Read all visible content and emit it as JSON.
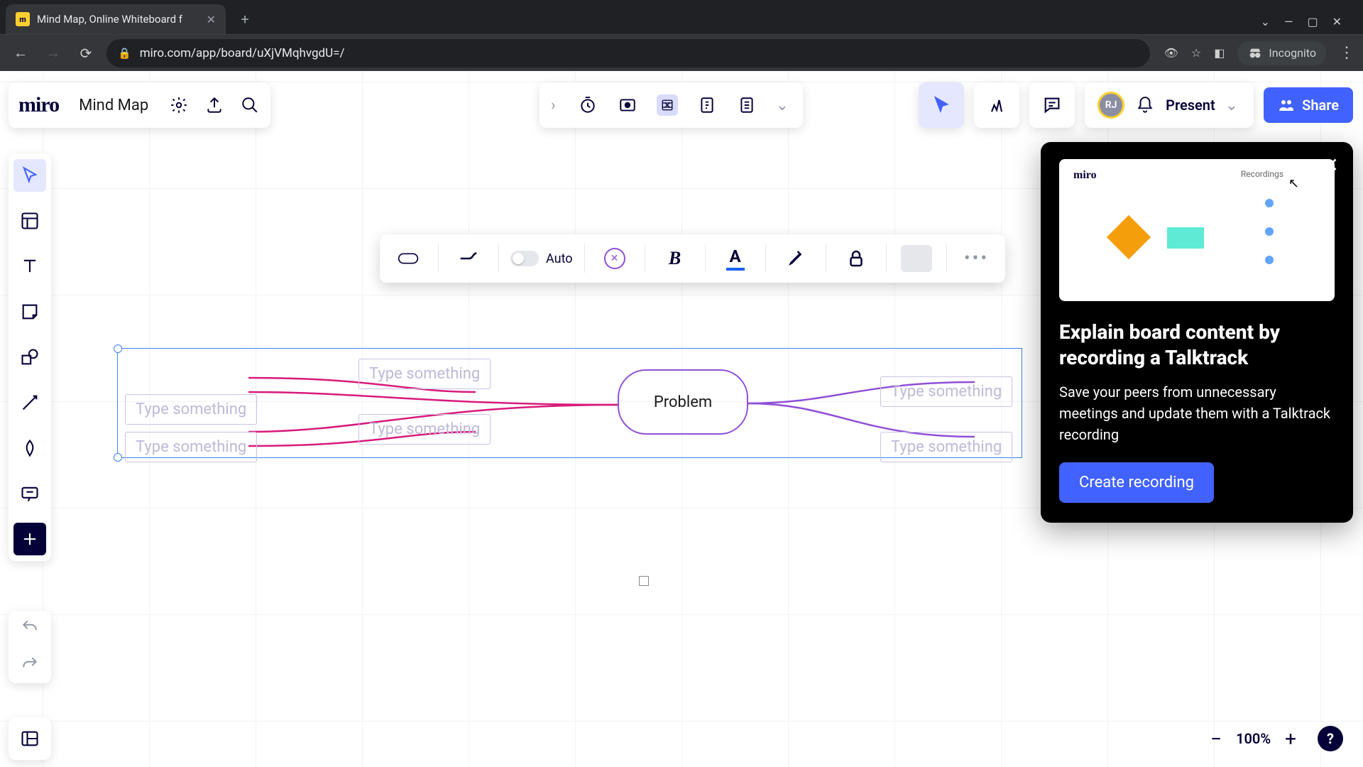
{
  "browser": {
    "tab_title": "Mind Map, Online Whiteboard f",
    "url": "miro.com/app/board/uXjVMqhvgdU=/",
    "incognito_label": "Incognito"
  },
  "header": {
    "logo": "miro",
    "board_name": "Mind Map",
    "present": "Present",
    "share": "Share"
  },
  "format_bar": {
    "auto": "Auto"
  },
  "mindmap": {
    "central": "Problem",
    "placeholder": "Type something"
  },
  "popup": {
    "title": "Explain board content by recording a Talktrack",
    "body": "Save your peers from unnecessary meetings and update them with a Talktrack recording",
    "cta": "Create recording",
    "mini_logo": "miro",
    "mini_rec": "Recordings"
  },
  "zoom": {
    "value": "100%"
  }
}
